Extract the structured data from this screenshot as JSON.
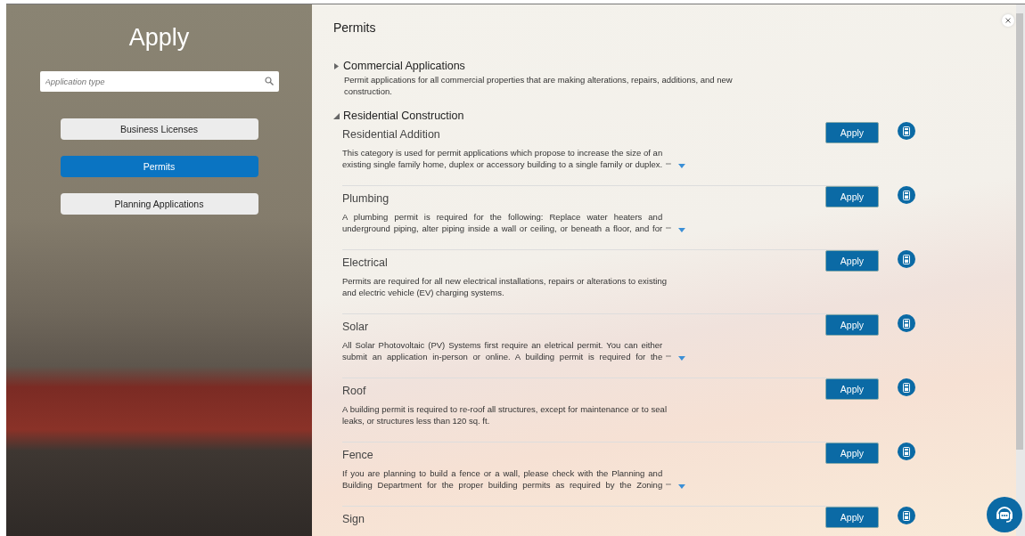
{
  "sidebar": {
    "title": "Apply",
    "search": {
      "placeholder": "Application type"
    },
    "items": [
      {
        "label": "Business Licenses",
        "selected": false
      },
      {
        "label": "Permits",
        "selected": true
      },
      {
        "label": "Planning Applications",
        "selected": false
      }
    ]
  },
  "content": {
    "title": "Permits",
    "categories": [
      {
        "label": "Commercial Applications",
        "expanded": false,
        "description": "Permit applications for all commercial properties that are making alterations, repairs, additions, and new construction."
      },
      {
        "label": "Residential Construction",
        "expanded": true,
        "items": [
          {
            "name": "Residential Addition",
            "description": "This category is used for permit applications which propose to increase the size of an existing single family home, duplex or accessory building to a single family or duplex.",
            "truncated": true,
            "button": "Apply"
          },
          {
            "name": "Plumbing",
            "description": "A plumbing permit is required for the following: Replace water heaters and underground piping, alter piping inside a wall or ceiling, or beneath a floor, and for",
            "truncated": true,
            "button": "Apply"
          },
          {
            "name": "Electrical",
            "description": "Permits are required for all new electrical installations, repairs or alterations to existing and electric vehicle (EV) charging systems.",
            "truncated": false,
            "button": "Apply"
          },
          {
            "name": "Solar",
            "description": "All Solar Photovoltaic (PV) Systems first require an eletrical permit. You can either submit an application in-person or online. A building permit is required for the",
            "truncated": true,
            "button": "Apply"
          },
          {
            "name": "Roof",
            "description": "A building permit is required to re-roof all structures, except for maintenance or to seal leaks, or structures less than 120 sq. ft.",
            "truncated": false,
            "button": "Apply"
          },
          {
            "name": "Fence",
            "description": "If you are planning to build a fence or a wall, please check with the Planning and Building Department for the proper building permits as required by the Zoning",
            "truncated": true,
            "button": "Apply"
          },
          {
            "name": "Sign",
            "button": "Apply"
          }
        ]
      }
    ]
  }
}
